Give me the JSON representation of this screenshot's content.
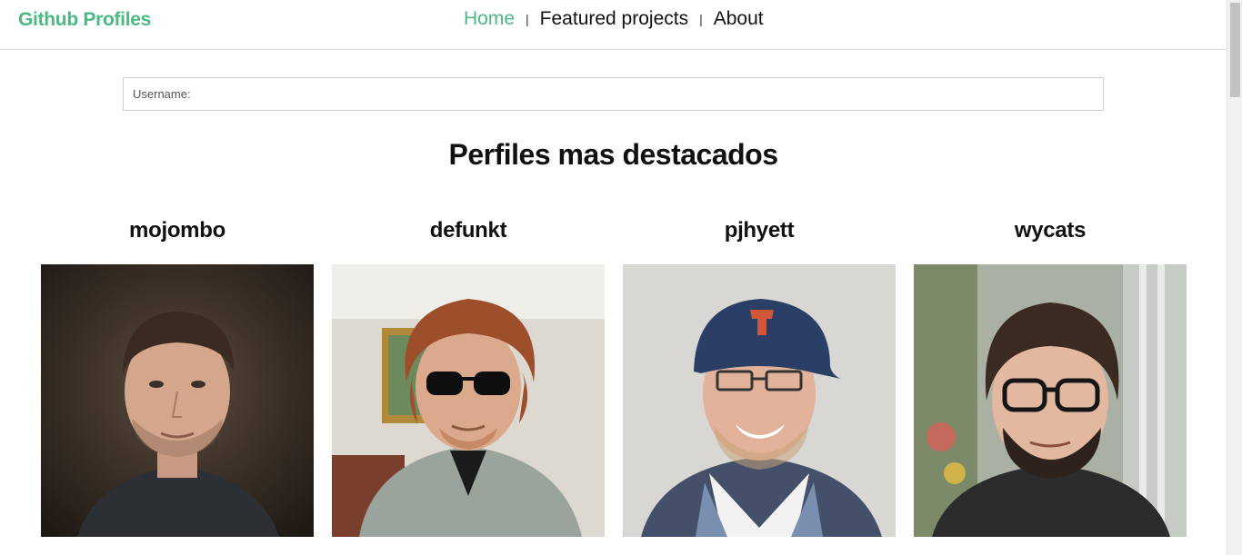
{
  "header": {
    "brand": "Github Profiles",
    "nav": [
      {
        "label": "Home",
        "active": true
      },
      {
        "label": "Featured projects",
        "active": false
      },
      {
        "label": "About",
        "active": false
      }
    ],
    "separator": "|"
  },
  "search": {
    "placeholder": "Username:",
    "value": ""
  },
  "main": {
    "title": "Perfiles mas destacados",
    "profiles": [
      {
        "username": "mojombo"
      },
      {
        "username": "defunkt"
      },
      {
        "username": "pjhyett"
      },
      {
        "username": "wycats"
      }
    ]
  },
  "colors": {
    "accent": "#4cb982",
    "text": "#111111",
    "border": "#cfcfcf"
  }
}
